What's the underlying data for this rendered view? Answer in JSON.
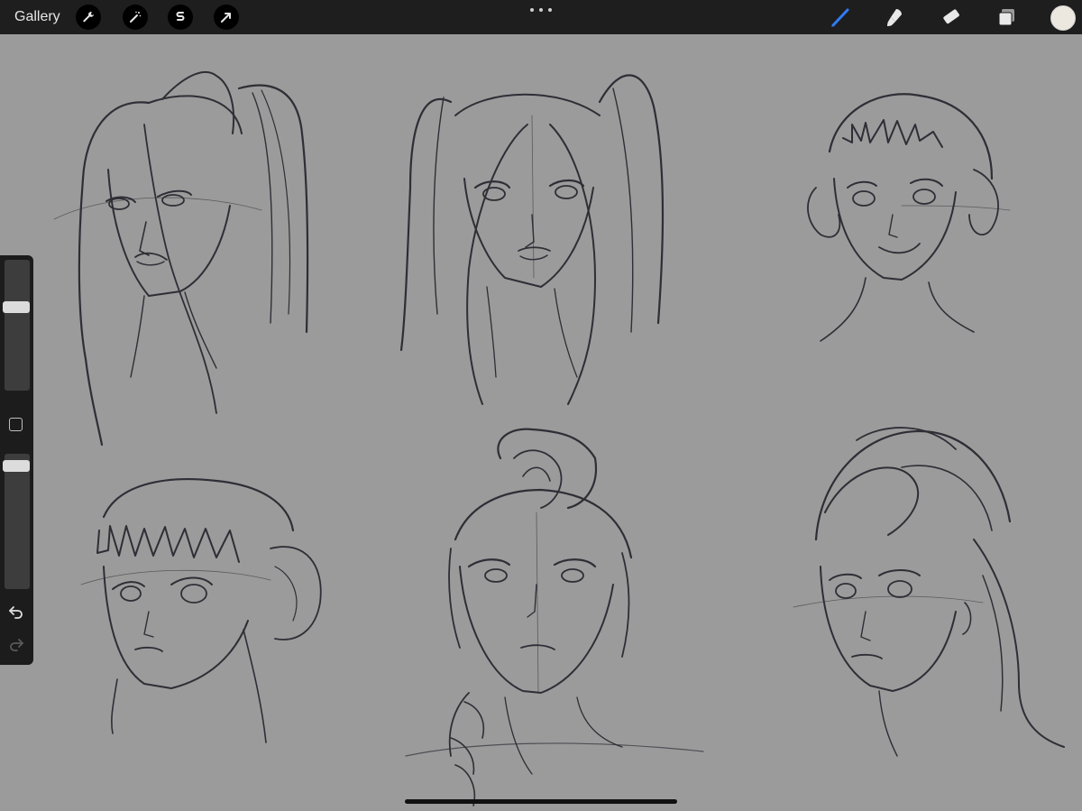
{
  "toolbar": {
    "gallery_label": "Gallery",
    "left_tools": [
      "wrench-icon",
      "magic-wand-icon",
      "selection-icon",
      "move-arrow-icon"
    ],
    "right_tools": [
      "brush-icon",
      "smudge-icon",
      "eraser-icon",
      "layers-icon"
    ],
    "active_tool_color": "#2f7cf6",
    "current_color": "#ece8e0"
  },
  "sidebar": {
    "brush_size_level": 0.65,
    "opacity_level": 0.95
  },
  "canvas": {
    "background": "#9b9b9b",
    "stroke_color": "#2e2e36"
  }
}
